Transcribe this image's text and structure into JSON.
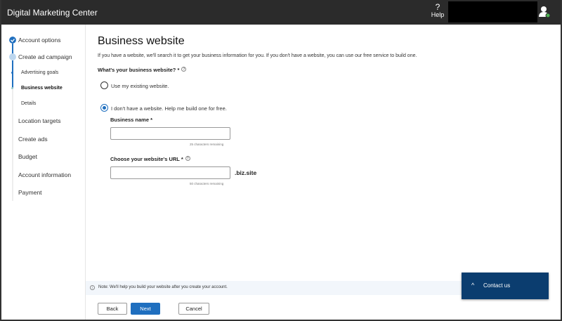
{
  "app": {
    "title": "Digital Marketing Center",
    "help_label": "Help",
    "help_icon": "?"
  },
  "sidebar": {
    "steps": [
      {
        "label": "Account options",
        "status": "complete"
      },
      {
        "label": "Create ad campaign",
        "status": "in-progress"
      },
      {
        "label": "Advertising goals",
        "status": "complete",
        "sub": true
      },
      {
        "label": "Business website",
        "status": "current",
        "sub": true
      },
      {
        "label": "Details",
        "status": "pending",
        "sub": true
      },
      {
        "label": "Location targets",
        "status": "pending"
      },
      {
        "label": "Create ads",
        "status": "pending"
      },
      {
        "label": "Budget",
        "status": "pending"
      },
      {
        "label": "Account information",
        "status": "pending"
      },
      {
        "label": "Payment",
        "status": "pending"
      }
    ]
  },
  "main": {
    "title": "Business website",
    "description": "If you have a website, we'll search it to get your business information for you. If you don't have a website, you can use our free service to build one.",
    "question": "What's your business website? *",
    "options": [
      {
        "label": "Use my existing website.",
        "selected": false
      },
      {
        "label": "I don't have a website. Help me build one for free.",
        "selected": true
      }
    ],
    "business_name": {
      "label": "Business name *",
      "value": "",
      "remaining": "25 characters remaining"
    },
    "url": {
      "label": "Choose your website's URL *",
      "value": "",
      "suffix": ".biz.site",
      "remaining": "50 characters remaining"
    },
    "note": "Note: We'll help you build your website after you create your account."
  },
  "buttons": {
    "back": "Back",
    "next": "Next",
    "cancel": "Cancel"
  },
  "contact": {
    "label": "Contact us"
  },
  "colors": {
    "accent": "#1f6fbf",
    "contact_bg": "#0b3d6f",
    "topbar": "#2b2b2b"
  }
}
